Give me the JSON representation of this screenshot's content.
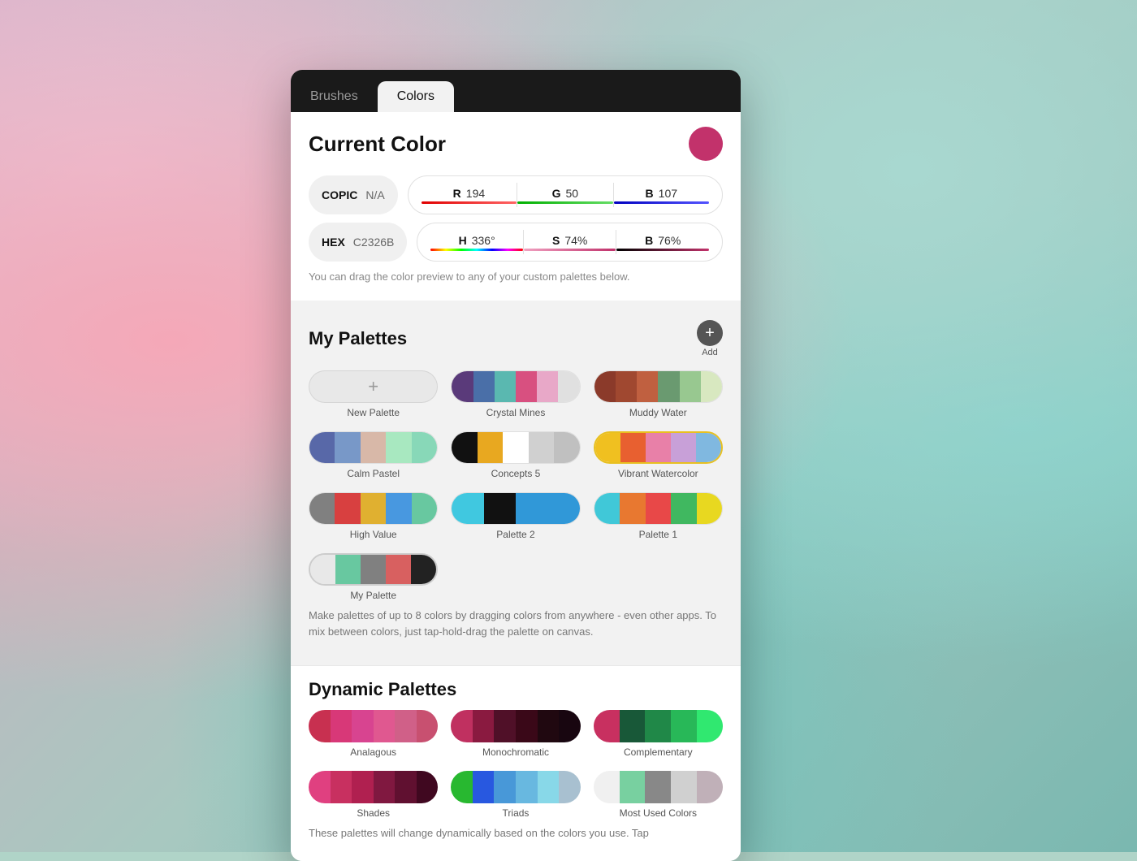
{
  "background": {
    "colors": [
      "#f5a8b8",
      "#a8d8d0",
      "#7ecfc8"
    ]
  },
  "tabs": [
    {
      "id": "brushes",
      "label": "Brushes",
      "active": false
    },
    {
      "id": "colors",
      "label": "Colors",
      "active": true
    }
  ],
  "current_color": {
    "title": "Current Color",
    "hex_value": "#C2326B",
    "copic_label": "COPIC",
    "copic_value": "N/A",
    "hex_label": "HEX",
    "hex_input": "C2326B",
    "r_label": "R",
    "r_value": "194",
    "g_label": "G",
    "g_value": "50",
    "b_label": "B",
    "b_value": "107",
    "h_label": "H",
    "h_value": "336°",
    "s_label": "S",
    "s_value": "74%",
    "brightness_label": "B",
    "brightness_value": "76%",
    "drag_hint": "You can drag the color preview to any of your custom palettes below."
  },
  "my_palettes": {
    "title": "My Palettes",
    "add_label": "Add",
    "palettes": [
      {
        "name": "New Palette",
        "type": "new",
        "segments": []
      },
      {
        "name": "Crystal Mines",
        "type": "color",
        "segments": [
          "#5a3a7a",
          "#4a6fa8",
          "#5ab8b0",
          "#d85080",
          "#e8a8c8",
          "#e0e0e0"
        ]
      },
      {
        "name": "Muddy Water",
        "type": "color",
        "segments": [
          "#8b3a2a",
          "#a04830",
          "#c06040",
          "#6a9a70",
          "#98c890",
          "#d8e8c0"
        ]
      },
      {
        "name": "Calm Pastel",
        "type": "color",
        "segments": [
          "#5868a8",
          "#7898c8",
          "#d8b8a8",
          "#a8e8c0",
          "#88d8b8"
        ]
      },
      {
        "name": "Concepts 5",
        "type": "color",
        "segments": [
          "#111111",
          "#e8a820",
          "#ffffff",
          "#d0d0d0",
          "#c0c0c0"
        ]
      },
      {
        "name": "Vibrant Watercolor",
        "type": "color",
        "segments": [
          "#f0c020",
          "#e86030",
          "#e880a8",
          "#c8a0d8",
          "#80b8e0"
        ]
      },
      {
        "name": "High Value",
        "type": "color",
        "segments": [
          "#808080",
          "#d84040",
          "#e0b030",
          "#4898e0",
          "#68c8a0"
        ]
      },
      {
        "name": "Palette 2",
        "type": "color",
        "segments": [
          "#40c8e0",
          "#111111",
          "#3098d8",
          "#80c0e0"
        ]
      },
      {
        "name": "Palette 1",
        "type": "color",
        "segments": [
          "#40c8d8",
          "#e87830",
          "#e84848",
          "#40b860",
          "#e8d820"
        ]
      },
      {
        "name": "My Palette",
        "type": "color",
        "segments": [
          "#e8e8e8",
          "#68c8a0",
          "#808080",
          "#d86060",
          "#222222"
        ]
      }
    ],
    "info_text": "Make palettes of up to 8 colors by dragging colors from anywhere - even other apps. To mix between colors, just tap-hold-drag the palette on canvas."
  },
  "dynamic_palettes": {
    "title": "Dynamic Palettes",
    "palettes": [
      {
        "name": "Analagous",
        "segments": [
          "#c83050",
          "#d83878",
          "#d84890",
          "#e05890",
          "#d06088",
          "#c85070"
        ]
      },
      {
        "name": "Monochromatic",
        "segments": [
          "#c03060",
          "#8a1a40",
          "#501028",
          "#3a0818",
          "#200810",
          "#180610"
        ]
      },
      {
        "name": "Complementary",
        "segments": [
          "#c83060",
          "#185838",
          "#208848",
          "#28b858",
          "#30e870"
        ]
      },
      {
        "name": "Shades",
        "segments": [
          "#e04080",
          "#c83060",
          "#b02050",
          "#801840",
          "#601030",
          "#400820"
        ]
      },
      {
        "name": "Triads",
        "segments": [
          "#28b830",
          "#2858e0",
          "#4898d8",
          "#68b8e0",
          "#88d8e8",
          "#a8c0d0"
        ]
      },
      {
        "name": "Most Used Colors",
        "segments": [
          "#e8e8e8",
          "#68c8a0",
          "#888888",
          "#d0d0d0",
          "#c0b0b8"
        ]
      }
    ],
    "bottom_hint": "These palettes will change dynamically based on the colors you use. Tap"
  }
}
